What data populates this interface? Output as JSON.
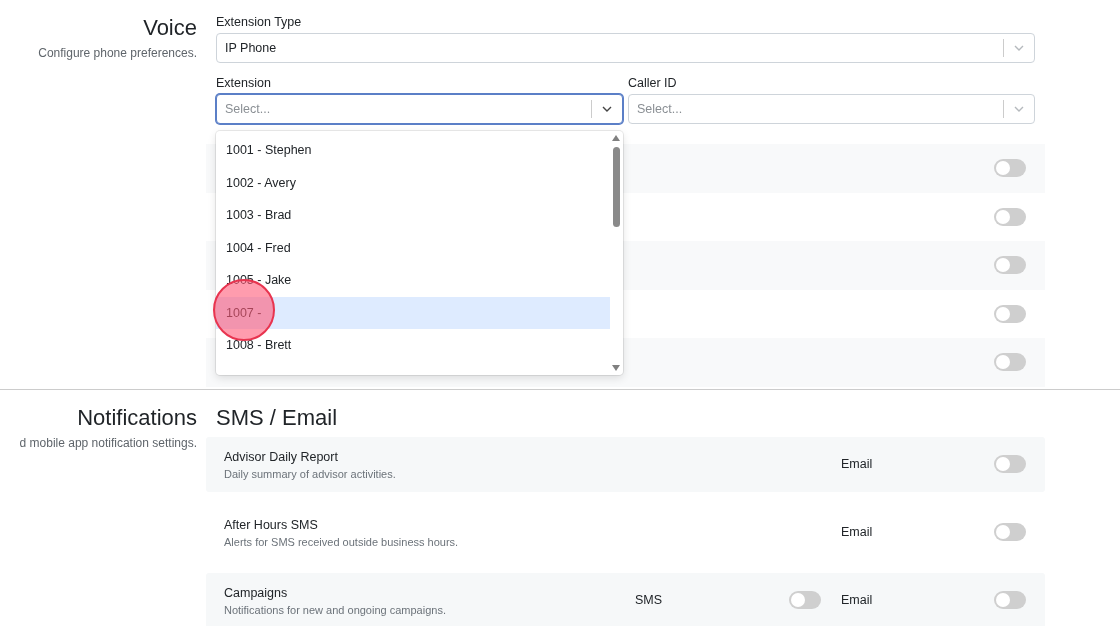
{
  "voice": {
    "title": "Voice",
    "description": "Configure phone preferences.",
    "extension_type": {
      "label": "Extension Type",
      "value": "IP Phone",
      "focused": false
    },
    "extension": {
      "label": "Extension",
      "placeholder": "Select...",
      "focused": true,
      "options": [
        {
          "label": "1001 - Stephen",
          "selected": false
        },
        {
          "label": "1002 - Avery",
          "selected": false
        },
        {
          "label": "1003 - Brad",
          "selected": false
        },
        {
          "label": "1004 - Fred",
          "selected": false
        },
        {
          "label": "1005 - Jake",
          "selected": false
        },
        {
          "label": "1007 -",
          "selected": true
        },
        {
          "label": "1008 - Brett",
          "selected": false
        }
      ]
    },
    "caller_id": {
      "label": "Caller ID",
      "placeholder": "Select...",
      "focused": false
    },
    "settings": [
      {
        "on": false
      },
      {
        "on": false
      },
      {
        "on": false
      },
      {
        "on": false
      },
      {
        "on": false
      }
    ]
  },
  "notifications": {
    "title": "Notifications",
    "description": "d mobile app notification settings.",
    "heading": "SMS / Email",
    "rows": [
      {
        "name": "Advisor Daily Report",
        "description": "Daily summary of advisor activities.",
        "channels": [
          {
            "kind": "email",
            "label": "Email",
            "on": false
          }
        ]
      },
      {
        "name": "After Hours SMS",
        "description": "Alerts for SMS received outside business hours.",
        "channels": [
          {
            "kind": "email",
            "label": "Email",
            "on": false
          }
        ]
      },
      {
        "name": "Campaigns",
        "description": "Notifications for new and ongoing campaigns.",
        "channels": [
          {
            "kind": "sms",
            "label": "SMS",
            "on": false
          },
          {
            "kind": "email",
            "label": "Email",
            "on": false
          }
        ]
      }
    ]
  }
}
